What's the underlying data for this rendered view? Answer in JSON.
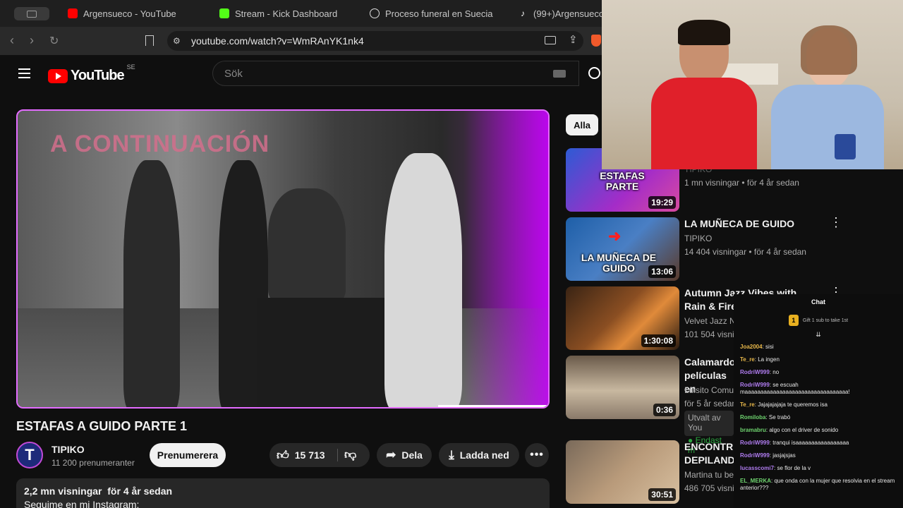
{
  "browser": {
    "tabs": [
      {
        "title": "Argensueco - YouTube",
        "color": "#ff0000"
      },
      {
        "title": "Stream - Kick Dashboard",
        "color": "#53fc18"
      },
      {
        "title": "Proceso funeral en Suecia",
        "color": "#dddddd"
      },
      {
        "title": "(99+)Argensueco",
        "color": "#ffffff"
      }
    ],
    "url": "youtube.com/watch?v=WmRAnYK1nk4"
  },
  "youtube": {
    "logo_text": "YouTube",
    "region": "SE",
    "search_placeholder": "Sök"
  },
  "video": {
    "overlay_text": "A CONTINUACIÓN",
    "title": "ESTAFAS A GUIDO PARTE 1",
    "channel": "TIPIKO",
    "channel_initial": "T",
    "subscribers": "11 200 prenumeranter",
    "subscribe_label": "Prenumerera",
    "likes": "15 713",
    "share_label": "Dela",
    "download_label": "Ladda ned",
    "views_date": "2,2 mn visningar  för 4 år sedan",
    "desc_line2": "Seguime en mi Instagram:"
  },
  "sidebar": {
    "filter_label": "Alla",
    "items": [
      {
        "title": "",
        "channel": "TIPIKO",
        "meta": "1 mn visningar • för 4 år sedan",
        "duration": "19:29",
        "thumb_text": "ESTAFAS PARTE"
      },
      {
        "title": "LA MUÑECA DE GUIDO",
        "channel": "TIPIKO",
        "meta": "14 404 visningar • för 4 år sedan",
        "duration": "13:06",
        "thumb_text": "LA MUÑECA DE GUIDO"
      },
      {
        "title": "Autumn Jazz Vibes with Rain & Fireplace W",
        "channel": "Velvet Jazz N",
        "meta": "101 504 visnin",
        "duration": "1:30:08",
        "thumb_text": ""
      },
      {
        "title": "Calamardo películas en",
        "channel": "Luisito Comun",
        "meta": "för 5 år sedan",
        "duration": "0:36",
        "thumb_text": "",
        "extra1": "Utvalt av You",
        "extra2": "Endast m"
      },
      {
        "title": "ENCONTRÉ DEPILANDO",
        "channel": "Martina tu be",
        "meta": "486 705 visni",
        "duration": "30:51",
        "thumb_text": ""
      }
    ]
  },
  "chat": {
    "header": "Chat",
    "gift_count": "1",
    "gift_text": "Gift 1 sub to take 1st",
    "messages": [
      {
        "user": "Joa2004",
        "text": "sisi",
        "color": "#e8b84a"
      },
      {
        "user": "Te_re",
        "text": "La ingen",
        "color": "#e8b84a"
      },
      {
        "user": "RodriW999",
        "text": "no",
        "color": "#b07cf0"
      },
      {
        "user": "RodriW999",
        "text": "se escuah maaaaaaaaaaaaaaaaaaaaaaaaaaaaaaaaa!",
        "color": "#b07cf0"
      },
      {
        "user": "Te_re",
        "text": "Jajajajajaja te queremos isa",
        "color": "#e8b84a"
      },
      {
        "user": "Romiloba",
        "text": "Se trabó",
        "color": "#6fd46f"
      },
      {
        "user": "bramabru",
        "text": "algo con el driver de sonido",
        "color": "#6fd46f"
      },
      {
        "user": "RodriW999",
        "text": "tranqui isaaaaaaaaaaaaaaaaa",
        "color": "#b07cf0"
      },
      {
        "user": "RodriW999",
        "text": "jasjajsjas",
        "color": "#b07cf0"
      },
      {
        "user": "lucasscomi7",
        "text": "se flor de la v",
        "color": "#b07cf0"
      },
      {
        "user": "EL_MERKA",
        "text": "que onda con la mujer que resolvia en el stream anterior???",
        "color": "#6fd46f"
      }
    ]
  }
}
